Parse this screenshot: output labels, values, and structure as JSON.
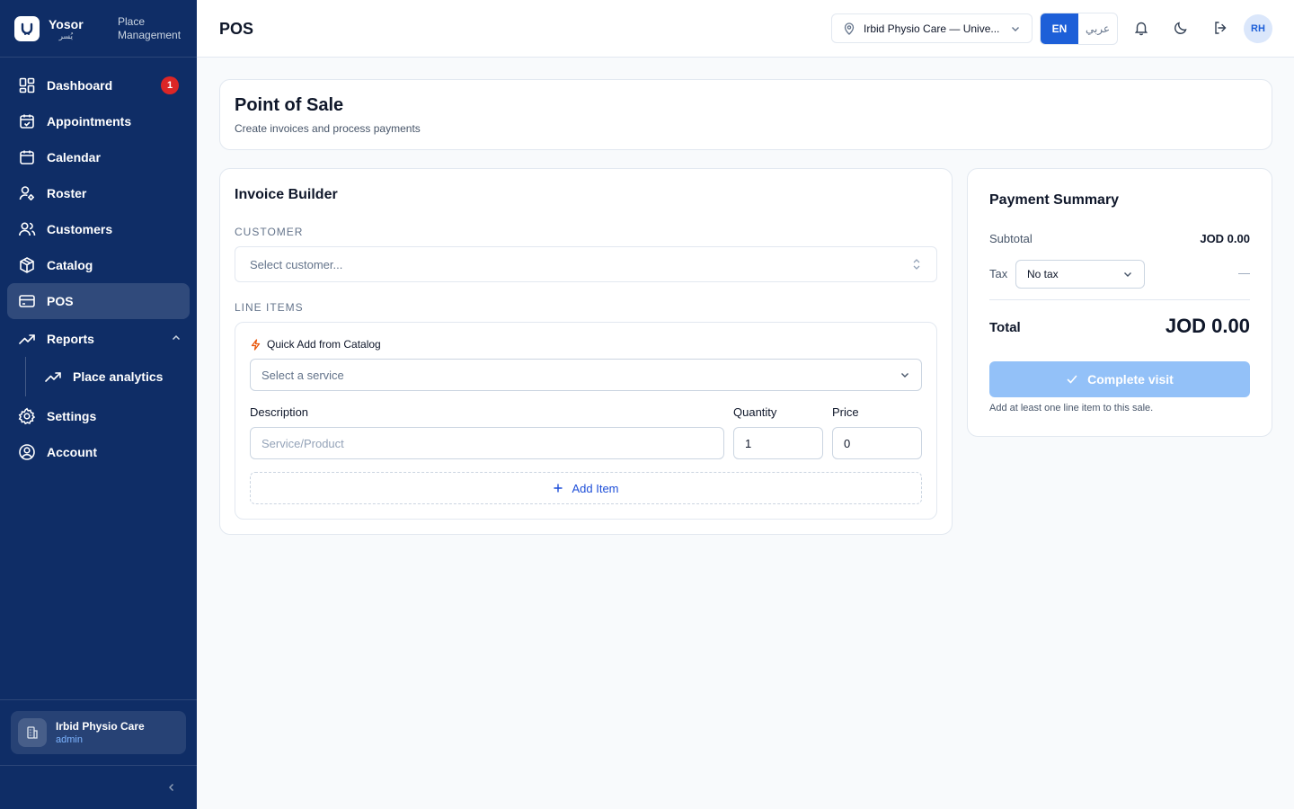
{
  "brand": {
    "name": "Yosor",
    "name_ar": "يُسر",
    "subtitle": "Place Management"
  },
  "sidebar": {
    "items": [
      {
        "label": "Dashboard",
        "icon": "dashboard-icon",
        "badge": "1"
      },
      {
        "label": "Appointments",
        "icon": "calendar-check-icon"
      },
      {
        "label": "Calendar",
        "icon": "calendar-icon"
      },
      {
        "label": "Roster",
        "icon": "user-gear-icon"
      },
      {
        "label": "Customers",
        "icon": "users-icon"
      },
      {
        "label": "Catalog",
        "icon": "box-icon"
      },
      {
        "label": "POS",
        "icon": "credit-card-icon",
        "active": true
      },
      {
        "label": "Reports",
        "icon": "trending-up-icon",
        "expanded": true
      },
      {
        "label": "Place analytics",
        "icon": "trending-up-icon",
        "sub": true
      },
      {
        "label": "Settings",
        "icon": "gear-icon"
      },
      {
        "label": "Account",
        "icon": "user-circle-icon"
      }
    ],
    "place": {
      "name": "Irbid Physio Care",
      "role": "admin"
    }
  },
  "header": {
    "title": "POS",
    "place_select": "Irbid Physio Care — Unive...",
    "lang_en": "EN",
    "lang_ar": "عربي",
    "avatar": "RH"
  },
  "hero": {
    "title": "Point of Sale",
    "subtitle": "Create invoices and process payments"
  },
  "invoice": {
    "title": "Invoice Builder",
    "customer_label": "CUSTOMER",
    "customer_placeholder": "Select customer...",
    "line_items_label": "LINE ITEMS",
    "quick_add_label": "Quick Add from Catalog",
    "service_placeholder": "Select a service",
    "description_label": "Description",
    "description_placeholder": "Service/Product",
    "quantity_label": "Quantity",
    "quantity_value": "1",
    "price_label": "Price",
    "price_value": "0",
    "add_item_label": "Add Item"
  },
  "summary": {
    "title": "Payment Summary",
    "subtotal_label": "Subtotal",
    "subtotal_value": "JOD 0.00",
    "tax_label": "Tax",
    "tax_select": "No tax",
    "tax_value": "—",
    "total_label": "Total",
    "total_value": "JOD 0.00",
    "complete_label": "Complete visit",
    "hint": "Add at least one line item to this sale."
  },
  "colors": {
    "sidebar": "#0f2d66",
    "accent": "#1d5fd8",
    "badge": "#dc2626",
    "disabled_button": "#93c1f8"
  }
}
